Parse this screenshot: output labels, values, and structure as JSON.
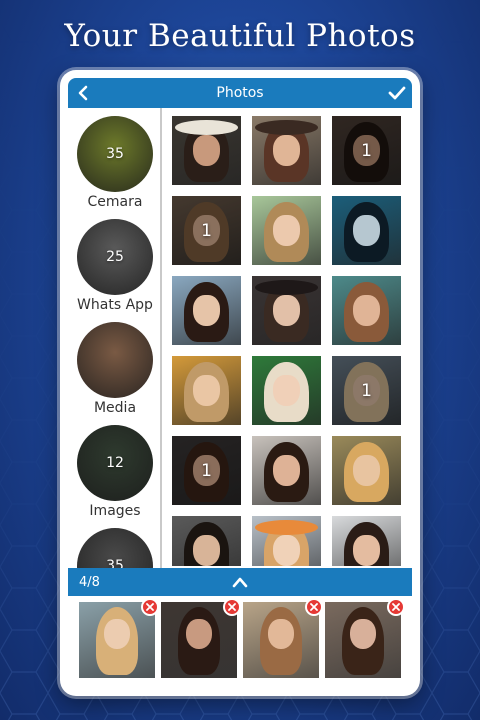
{
  "headline": "Your Beautiful Photos",
  "header": {
    "title": "Photos",
    "back_icon": "chevron-left-icon",
    "confirm_icon": "check-icon"
  },
  "albums": [
    {
      "name": "Cemara",
      "count": "35",
      "color": "#6d7a2a"
    },
    {
      "name": "Whats App",
      "count": "25",
      "color": "#5a5a5a"
    },
    {
      "name": "Media",
      "count": "",
      "color": "#7a5a44"
    },
    {
      "name": "Images",
      "count": "12",
      "color": "#2e3a2e"
    },
    {
      "name": "",
      "count": "35",
      "color": "#4a4a4a"
    }
  ],
  "photos": [
    {
      "badge": "",
      "bg": "#3a3630",
      "skin": "#c8997c",
      "hair": "#2a1e18",
      "hat": "#e9e4d8"
    },
    {
      "badge": "",
      "bg": "#8a7a68",
      "skin": "#e0b596",
      "hair": "#5a3526",
      "hat": "#3a2a22"
    },
    {
      "badge": "1",
      "bg": "#4a3c34",
      "skin": "#b48a70",
      "hair": "#1e1410",
      "hat": ""
    },
    {
      "badge": "1",
      "bg": "#6a5848",
      "skin": "#d5ac90",
      "hair": "#7a5a3c",
      "hat": ""
    },
    {
      "badge": "",
      "bg": "#a8c79a",
      "skin": "#ecc9ad",
      "hair": "#b08a58",
      "hat": ""
    },
    {
      "badge": "",
      "bg": "#1b5e7a",
      "skin": "#b6c7d0",
      "hair": "#0c1a24",
      "hat": ""
    },
    {
      "badge": "",
      "bg": "#8aa8c0",
      "skin": "#e6c4a8",
      "hair": "#2a1a14",
      "hat": ""
    },
    {
      "badge": "",
      "bg": "#3a3434",
      "skin": "#e2c0a8",
      "hair": "#3a2a22",
      "hat": "#1e1818"
    },
    {
      "badge": "",
      "bg": "#4d8a8a",
      "skin": "#e0b496",
      "hair": "#8a5a3a",
      "hat": ""
    },
    {
      "badge": "",
      "bg": "#d49a3a",
      "skin": "#eac6a4",
      "hair": "#c09a68",
      "hat": ""
    },
    {
      "badge": "",
      "bg": "#2e7a3a",
      "skin": "#f0d0b8",
      "hair": "#e8dcc8",
      "hat": ""
    },
    {
      "badge": "1",
      "bg": "#6a7a88",
      "skin": "#d8b8a0",
      "hair": "#c8b08a",
      "hat": ""
    },
    {
      "badge": "1",
      "bg": "#3a3636",
      "skin": "#d4a88c",
      "hair": "#3a2218",
      "hat": ""
    },
    {
      "badge": "",
      "bg": "#c8c2bc",
      "skin": "#deb296",
      "hair": "#2a1a12",
      "hat": ""
    },
    {
      "badge": "",
      "bg": "#9a8a5a",
      "skin": "#e8c4a0",
      "hair": "#d8a860",
      "hat": ""
    },
    {
      "badge": "",
      "bg": "#5a5a5a",
      "skin": "#d8b498",
      "hair": "#1a1410",
      "hat": ""
    },
    {
      "badge": "",
      "bg": "#b8c0c8",
      "skin": "#f0d2b8",
      "hair": "#d8a468",
      "hat": "#e88a3a"
    },
    {
      "badge": "",
      "bg": "#d8dadc",
      "skin": "#e4bca0",
      "hair": "#2a1c16",
      "hat": ""
    }
  ],
  "selection": {
    "counter": "4/8",
    "expand_icon": "chevron-up-icon",
    "items": [
      {
        "bg": "#8aa0a8",
        "skin": "#ecccb0",
        "hair": "#d8b078"
      },
      {
        "bg": "#3e3632",
        "skin": "#c89a80",
        "hair": "#2a1a14"
      },
      {
        "bg": "#b8a488",
        "skin": "#e2b898",
        "hair": "#9a6a44"
      },
      {
        "bg": "#7a6a5e",
        "skin": "#d8b09a",
        "hair": "#3a2418"
      }
    ]
  },
  "colors": {
    "accent": "#1a7bbd",
    "remove": "#e53935"
  }
}
